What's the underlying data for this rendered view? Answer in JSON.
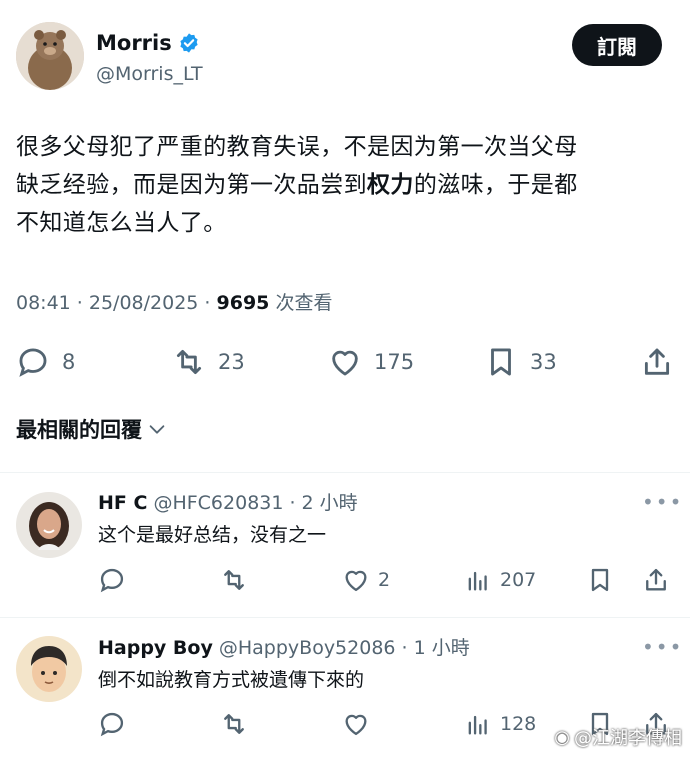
{
  "author": {
    "name": "Morris",
    "handle": "@Morris_LT",
    "verified_color": "#1d9bf0"
  },
  "follow_label": "訂閱",
  "tweet": {
    "line1": "很多父母犯了严重的教育失误，不是因为第一次当父母",
    "line2_pre": "缺乏经验，而是因为第一次品尝到",
    "line2_bold": "权力",
    "line2_post": "的滋味，于是都",
    "line3": "不知道怎么当人了。"
  },
  "meta": {
    "time": "08:41 · 25/08/2025 · ",
    "views": "9695",
    "views_label": " 次查看"
  },
  "actions": {
    "replies": "8",
    "reposts": "23",
    "likes": "175",
    "bookmarks": "33"
  },
  "replies_heading": "最相關的回覆",
  "replies": [
    {
      "name": "HF C",
      "handle": "@HFC620831",
      "time": "· 2 小時",
      "text": "这个是最好总结，没有之一",
      "views": "207",
      "likes": "2"
    },
    {
      "name": "Happy Boy",
      "handle": "@HappyBoy52086",
      "time": "· 1 小時",
      "text": "倒不如說教育方式被遺傳下來的",
      "views": "128"
    }
  ],
  "watermark": "@江湖李傳相",
  "colors": {
    "text": "#0f1419",
    "muted": "#536471",
    "verified": "#1d9bf0",
    "divider": "#eff3f4"
  }
}
